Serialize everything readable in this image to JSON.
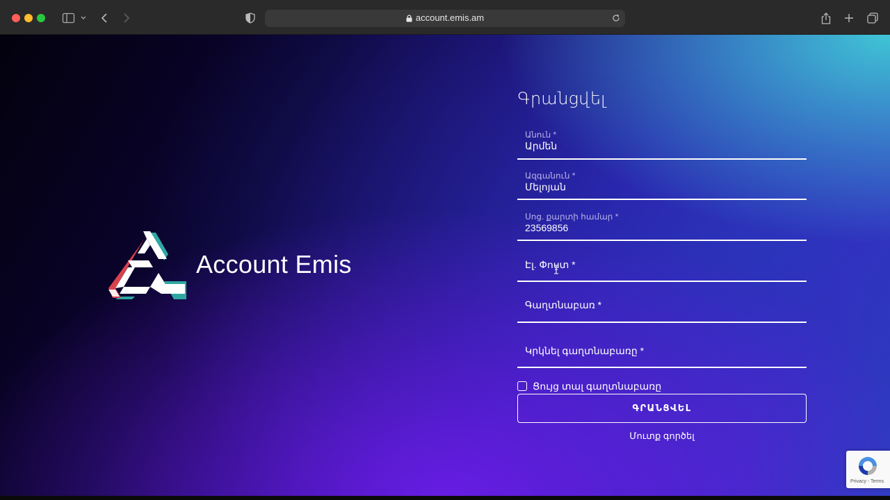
{
  "browser": {
    "url": "account.emis.am"
  },
  "brand": {
    "name": "Account Emis"
  },
  "form": {
    "title": "Գրանցվել",
    "fields": [
      {
        "label": "Անուն *",
        "value": "Արմեն"
      },
      {
        "label": "Ազգանուն *",
        "value": "Մելոյան"
      },
      {
        "label": "Սոց. քարտի համար *",
        "value": "23569856"
      },
      {
        "placeholder": "Էլ. Փոստ *"
      },
      {
        "placeholder": "Գաղտնաբառ *"
      },
      {
        "placeholder": "Կրկնել գաղտնաբառը *"
      }
    ],
    "show_password_label": "Ցույց տալ գաղտնաբառը",
    "show_password_checked": false,
    "submit_label": "ԳՐԱՆՑՎԵԼ",
    "login_link": "Մուտք գործել"
  },
  "recaptcha": {
    "footer": "Privacy - Terms"
  }
}
